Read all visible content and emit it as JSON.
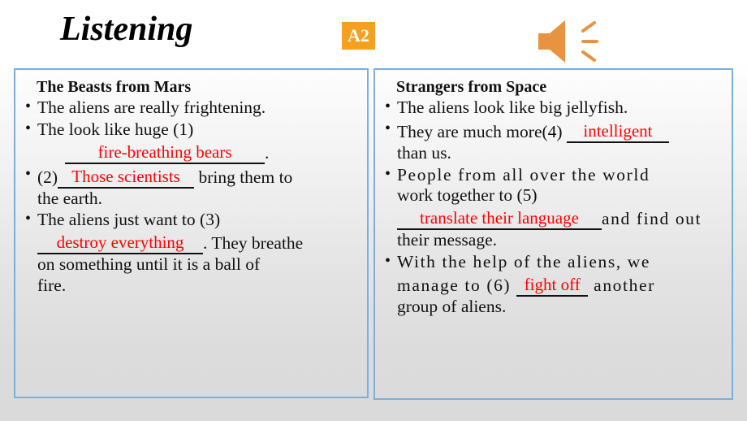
{
  "slide": {
    "title": "Listening",
    "badge": "A2",
    "speaker_icon": "speaker-icon",
    "accent_orange": "#F5A01E",
    "speaker_orange": "#E8933F",
    "border_blue": "#79B0DE",
    "answer_red": "#FF0000"
  },
  "left_column": {
    "heading": "The Beasts from Mars",
    "bullets": [
      {
        "parts": [
          {
            "type": "text",
            "value": "The aliens are really frightening."
          }
        ]
      },
      {
        "parts": [
          {
            "type": "text",
            "value": "The look like huge (1)"
          },
          {
            "type": "blank",
            "number": "1",
            "answer": "fire-breathing bears"
          },
          {
            "type": "text",
            "value": "."
          }
        ]
      },
      {
        "parts": [
          {
            "type": "text",
            "value": "(2)"
          },
          {
            "type": "blank",
            "number": "2",
            "answer": "Those scientists"
          },
          {
            "type": "text",
            "value": "bring them to the earth."
          }
        ]
      },
      {
        "parts": [
          {
            "type": "text",
            "value": "The aliens just want to (3)"
          },
          {
            "type": "blank",
            "number": "3",
            "answer": "destroy everything"
          },
          {
            "type": "text",
            "value": ". They breathe on something until it is a ball of fire."
          }
        ]
      }
    ],
    "lines": {
      "b1": "The aliens are really frightening.",
      "b2_a": "The look like huge (1)",
      "b2_ans": "fire-breathing bears",
      "b2_tail": ".",
      "b3_a": "(2)",
      "b3_ans": "Those scientists",
      "b3_b": "bring them to",
      "b3_c": "the earth.",
      "b4_a": "The aliens just want to (3)",
      "b4_ans": "destroy everything",
      "b4_b": ". They breathe",
      "b4_c": "on something until it is a ball of",
      "b4_d": "fire."
    }
  },
  "right_column": {
    "heading": "Strangers from Space",
    "bullets": [
      {
        "parts": [
          {
            "type": "text",
            "value": "The aliens look like big jellyfish."
          }
        ]
      },
      {
        "parts": [
          {
            "type": "text",
            "value": "They are much more(4)"
          },
          {
            "type": "blank",
            "number": "4",
            "answer": "intelligent"
          },
          {
            "type": "text",
            "value": "than us."
          }
        ]
      },
      {
        "parts": [
          {
            "type": "text",
            "value": "People from all over the world work together to (5)"
          },
          {
            "type": "blank",
            "number": "5",
            "answer": "translate their language"
          },
          {
            "type": "text",
            "value": "and find out their message."
          }
        ]
      },
      {
        "parts": [
          {
            "type": "text",
            "value": "With the help of the aliens, we manage to (6)"
          },
          {
            "type": "blank",
            "number": "6",
            "answer": "fight off"
          },
          {
            "type": "text",
            "value": "another group of aliens."
          }
        ]
      }
    ],
    "lines": {
      "b1": "The aliens look like big jellyfish.",
      "b2_a": "They are much more(4)",
      "b2_ans": "intelligent",
      "b2_b": "than us.",
      "b3_a": "People from all over the world",
      "b3_b": "work together to (5)",
      "b3_ans": "translate their language",
      "b3_c": "and find out",
      "b3_d": "their message.",
      "b4_a": "With the help of the aliens, we",
      "b4_b": "manage to (6)",
      "b4_ans": "fight off",
      "b4_c": "another",
      "b4_d": "group of aliens."
    }
  }
}
